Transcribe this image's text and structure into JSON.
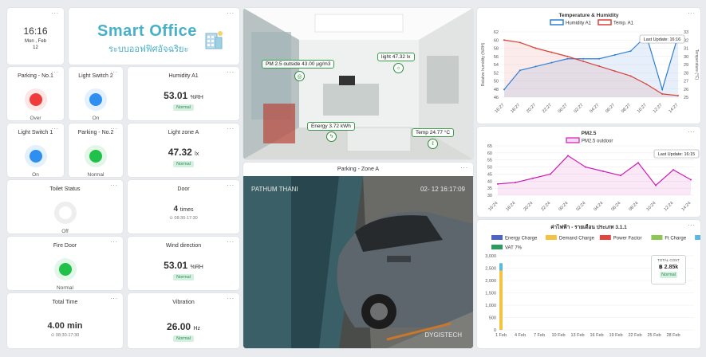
{
  "clock": {
    "time": "16:16",
    "date_line1": "Mon , Feb",
    "date_line2": "12"
  },
  "brand": {
    "title": "Smart Office",
    "subtitle": "ระบบออฟฟิศอัจฉริยะ"
  },
  "tiles": {
    "parking1": {
      "title": "Parking - No.1",
      "status": "Over",
      "color": "#ef3b3b",
      "ring": "#fde6e6"
    },
    "light2": {
      "title": "Light Switch 2",
      "status": "On",
      "color": "#2e8ff0",
      "ring": "#e3f0fd"
    },
    "humidity": {
      "title": "Humidity A1",
      "value": "53.01",
      "unit": "%RH",
      "badge": "Normal"
    },
    "light1": {
      "title": "Light Switch 1",
      "status": "On",
      "color": "#2e8ff0",
      "ring": "#e3f0fd"
    },
    "parking2": {
      "title": "Parking - No.2",
      "status": "Normal",
      "color": "#21c04a",
      "ring": "#e2f7e8"
    },
    "lightzone": {
      "title": "Light zone A",
      "value": "47.32",
      "unit": "lx",
      "badge": "Normal"
    },
    "toilet": {
      "title": "Toilet Status",
      "status": "Off",
      "color": "#ffffff",
      "ring": "#eeeeee"
    },
    "door": {
      "title": "Door",
      "value": "4",
      "unit": "times",
      "sub": "⊙ 08:30-17:30"
    },
    "firedoor": {
      "title": "Fire Door",
      "status": "Normal",
      "color": "#21c04a",
      "ring": "#e2f7e8"
    },
    "wind": {
      "title": "Wind direction",
      "value": "53.01",
      "unit": "%RH",
      "badge": "Normal"
    },
    "totaltime": {
      "title": "Total Time",
      "value": "4.00 min",
      "sub": "⊙ 08:30-17:30"
    },
    "vibration": {
      "title": "Vibration",
      "value": "26.00",
      "unit": "Hz",
      "badge": "Normal"
    }
  },
  "office_view": {
    "pm": "PM 2.5 outside 43.00 µg/m3",
    "light": "light 47.32 lx",
    "energy": "Energy 3.72 kWh",
    "temp": "Temp 24.77 °C"
  },
  "camera": {
    "title": "Parking - Zone A",
    "overlay_left": "PATHUM THANI",
    "overlay_right": "02- 12 16:17:09",
    "watermark": "DYGISTECH"
  },
  "charts": {
    "temp_hum": {
      "title": "Temperature & Humidity",
      "last_update": "Last Update: 16:16",
      "ylabel_left": "Relative humidity (%RH)",
      "ylabel_right": "Temperature (°C)",
      "series_names": [
        "Humidity A1",
        "Temp. A1"
      ],
      "colors": [
        "#2f7fd6",
        "#d9403a"
      ],
      "yleft_ticks": [
        "62",
        "60",
        "58",
        "56",
        "54",
        "52",
        "50",
        "48",
        "46"
      ],
      "yright_ticks": [
        "33",
        "32",
        "31",
        "30",
        "29",
        "28",
        "27",
        "26",
        "25"
      ],
      "x_ticks": [
        "16:27",
        "18:27",
        "20:27",
        "22:27",
        "00:27",
        "02:27",
        "04:27",
        "06:27",
        "08:27",
        "10:27",
        "12:27",
        "14:27"
      ]
    },
    "pm25": {
      "title": "PM2.5",
      "legend": "PM2.5 outdoor",
      "last_update": "Last Update: 16:15",
      "color": "#cc1fb4",
      "y_ticks": [
        "65",
        "60",
        "55",
        "50",
        "45",
        "40",
        "35",
        "30"
      ],
      "x_ticks": [
        "16:24",
        "18:24",
        "20:24",
        "22:24",
        "00:24",
        "02:24",
        "04:24",
        "06:24",
        "08:24",
        "10:24",
        "12:24",
        "14:24"
      ]
    },
    "bill": {
      "title": "ค่าไฟฟ้า - รายเดือน ประเภท 3.1.1",
      "legend": [
        {
          "name": "Energy Charge",
          "color": "#4e63c7"
        },
        {
          "name": "Demand Charge",
          "color": "#f5c342"
        },
        {
          "name": "Power Factor",
          "color": "#e2453c"
        },
        {
          "name": "Ft Charge",
          "color": "#8cc751"
        },
        {
          "name": "Service",
          "color": "#5bb9e0"
        },
        {
          "name": "VAT 7%",
          "color": "#2a9d5e"
        }
      ],
      "y_ticks": [
        "3,000",
        "2,500",
        "2,000",
        "1,500",
        "1,000",
        "500",
        "0"
      ],
      "x_ticks": [
        "1 Feb",
        "4 Feb",
        "7 Feb",
        "10 Feb",
        "13 Feb",
        "16 Feb",
        "19 Feb",
        "22 Feb",
        "25 Feb",
        "28 Feb"
      ],
      "total_label": "TOTAL COST",
      "total_value": "฿ 2.85k",
      "total_badge": "Normal"
    }
  },
  "chart_data": [
    {
      "type": "line",
      "title": "Temperature & Humidity",
      "x": [
        "16:27",
        "18:27",
        "20:27",
        "22:27",
        "00:27",
        "02:27",
        "04:27",
        "06:27",
        "08:27",
        "10:27",
        "12:27",
        "14:27"
      ],
      "series": [
        {
          "name": "Humidity A1",
          "axis": "left",
          "values": [
            47,
            52,
            53,
            54,
            55,
            55,
            55,
            56,
            57,
            61,
            47,
            61
          ]
        },
        {
          "name": "Temp. A1",
          "axis": "right",
          "values": [
            32,
            31.7,
            31,
            30.5,
            30,
            29.4,
            28.8,
            28.2,
            27.6,
            26.6,
            25.4,
            25.2
          ]
        }
      ],
      "ylim_left": [
        45,
        62
      ],
      "ylim_right": [
        25,
        33
      ]
    },
    {
      "type": "line",
      "title": "PM2.5",
      "x": [
        "16:24",
        "18:24",
        "20:24",
        "22:24",
        "00:24",
        "02:24",
        "04:24",
        "06:24",
        "08:24",
        "10:24",
        "12:24",
        "14:24"
      ],
      "series": [
        {
          "name": "PM2.5 outdoor",
          "values": [
            38,
            39,
            42,
            45,
            58,
            50,
            47,
            44,
            53,
            37,
            48,
            41
          ]
        }
      ],
      "ylim": [
        30,
        65
      ]
    },
    {
      "type": "bar",
      "title": "ค่าไฟฟ้า - รายเดือน ประเภท 3.1.1",
      "categories": [
        "1 Feb"
      ],
      "series": [
        {
          "name": "Demand Charge",
          "values": [
            2400
          ]
        },
        {
          "name": "Service",
          "values": [
            300
          ]
        }
      ],
      "ylim": [
        0,
        3000
      ]
    }
  ]
}
